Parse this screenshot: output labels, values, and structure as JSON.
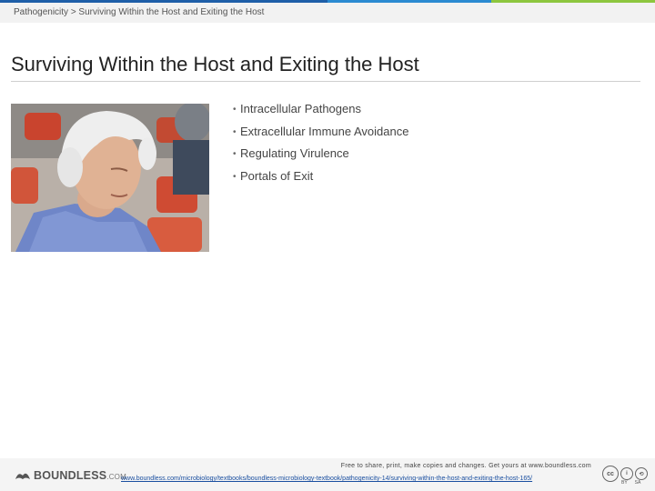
{
  "theme": {
    "bar_colors": [
      "#1f5fa8",
      "#1f5fa8",
      "#2b8ad1",
      "#8dc63f"
    ]
  },
  "breadcrumb": "Pathogenicity > Surviving Within the Host and Exiting the Host",
  "slide": {
    "title": "Surviving Within the Host and Exiting the Host",
    "bullets": [
      "Intracellular Pathogens",
      "Extracellular Immune Avoidance",
      "Regulating Virulence",
      "Portals of Exit"
    ],
    "bullet_glyph": "•"
  },
  "footer": {
    "logo_main": "BOUNDLESS",
    "logo_suffix": ".COM",
    "note": "Free to share, print, make copies and changes. Get yours at www.boundless.com",
    "url": "www.boundless.com/microbiology/textbooks/boundless-microbiology-textbook/pathogenicity-14/surviving-within-the-host-and-exiting-the-host-165/",
    "license_badges": [
      "cc",
      "i",
      "⟲"
    ],
    "license_labels": [
      "BY",
      "SA"
    ]
  }
}
